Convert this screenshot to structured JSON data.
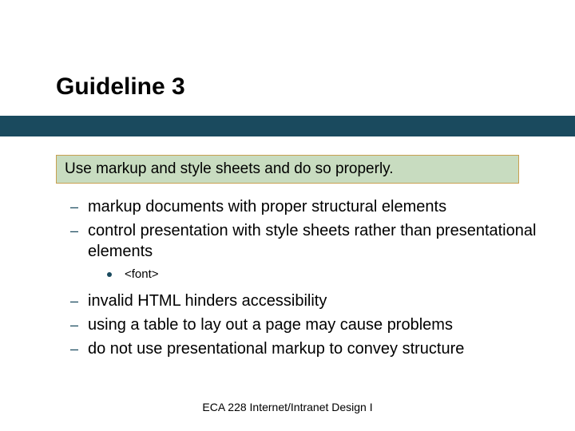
{
  "title": "Guideline 3",
  "callout": "Use markup and style sheets and do so properly.",
  "items": [
    {
      "text": "markup documents with proper structural elements"
    },
    {
      "text": "control presentation with style sheets rather than presentational elements"
    }
  ],
  "sub": {
    "text": "<font>"
  },
  "items2": [
    {
      "text": "invalid HTML hinders accessibility"
    },
    {
      "text": "using a table to lay out a page may cause problems"
    },
    {
      "text": "do not use presentational markup to convey structure"
    }
  ],
  "footer": "ECA 228  Internet/Intranet Design I"
}
